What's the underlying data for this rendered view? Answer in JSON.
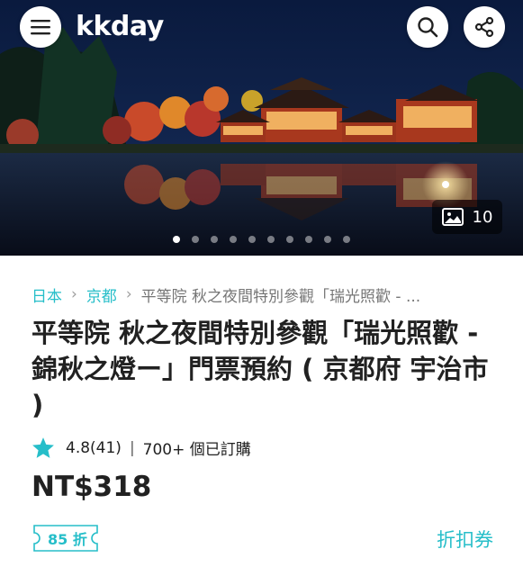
{
  "header": {
    "logo_text": "kkday",
    "menu_icon": "menu-icon",
    "search_icon": "search-icon",
    "share_icon": "share-icon"
  },
  "gallery": {
    "photo_count": "10",
    "image_icon": "image-icon",
    "slide_count": 10,
    "active_index": 0
  },
  "breadcrumb": [
    {
      "label": "日本"
    },
    {
      "label": "京都"
    },
    {
      "label": "平等院 秋之夜間特別參觀「瑞光照歡 - ..."
    }
  ],
  "product": {
    "title": "平等院 秋之夜間特別參觀「瑞光照歡 - 錦秋之燈ー」門票預約 ( 京都府 宇治市 )",
    "rating": "4.8(41)",
    "booked": "700+ 個已訂購",
    "price": "NT$318",
    "discount_badge": "85 折",
    "coupon_link": "折扣券"
  },
  "colors": {
    "accent": "#26bec9",
    "text": "#212121",
    "muted": "#757575"
  }
}
